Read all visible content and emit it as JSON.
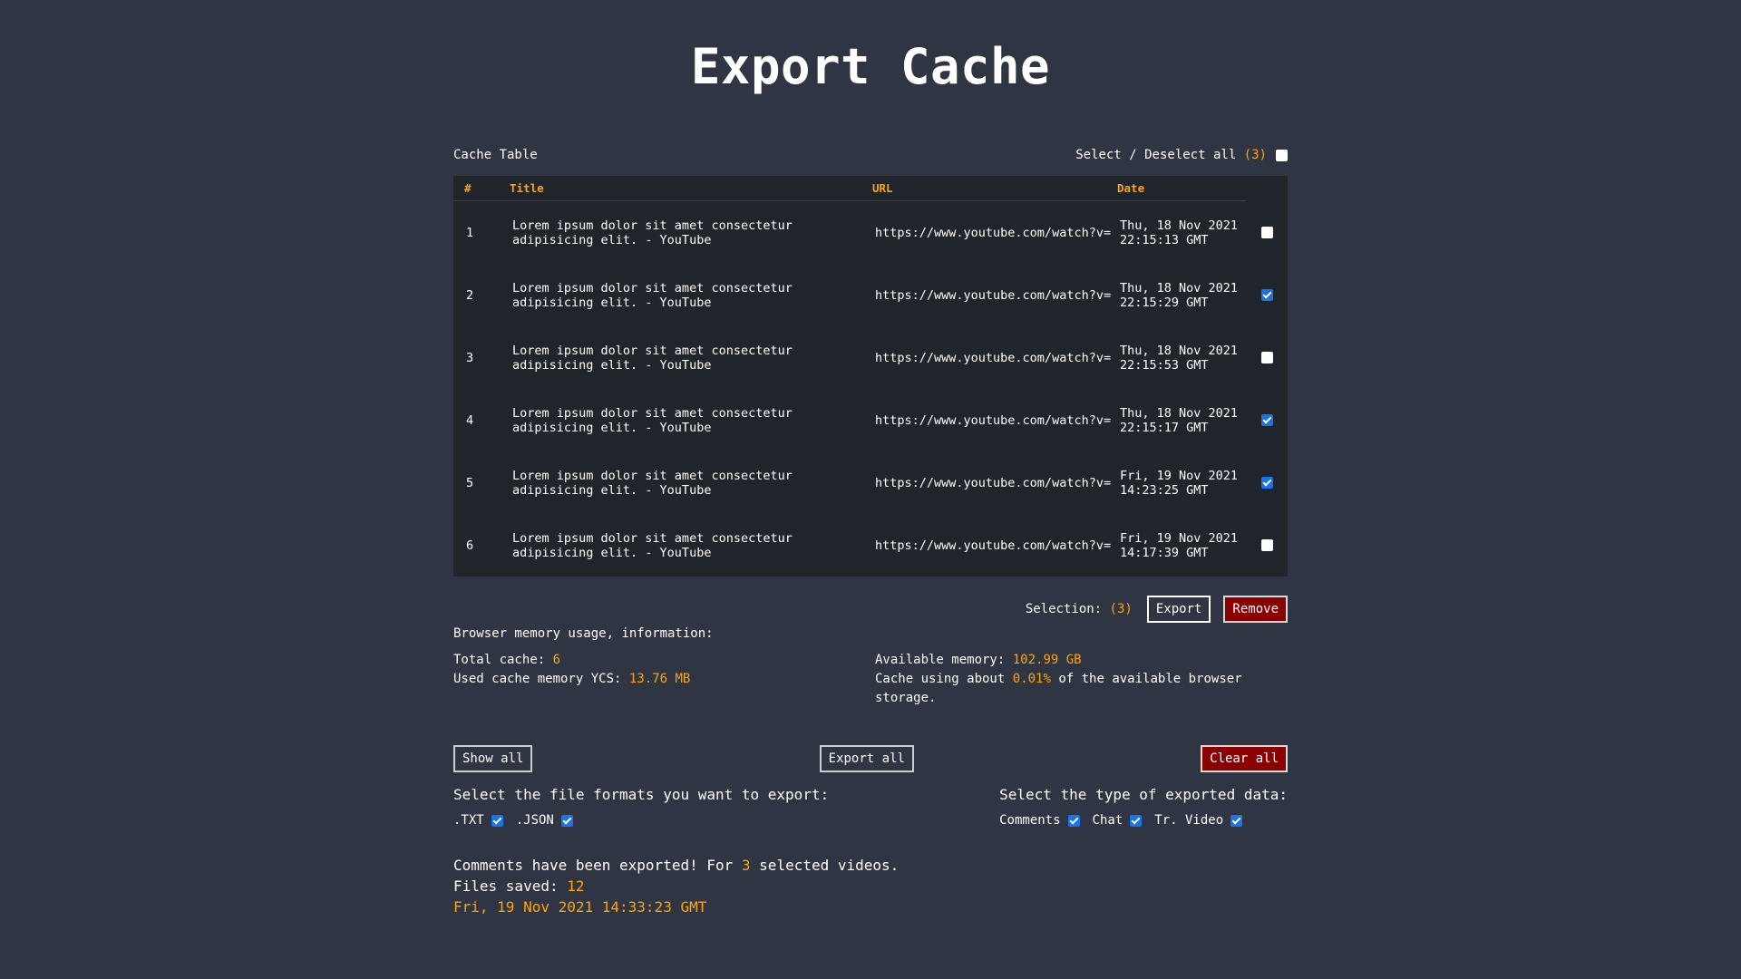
{
  "title": "Export Cache",
  "cache_table": {
    "label": "Cache Table",
    "select_all_label": "Select / Deselect all",
    "select_all_count": "(3)",
    "columns": {
      "num": "#",
      "title": "Title",
      "url": "URL",
      "date": "Date"
    },
    "rows": [
      {
        "num": "1",
        "title": "Lorem ipsum dolor sit amet consectetur adipisicing elit. - YouTube",
        "url": "https://www.youtube.com/watch?v=",
        "date": "Thu, 18 Nov 2021 22:15:13 GMT",
        "checked": false
      },
      {
        "num": "2",
        "title": "Lorem ipsum dolor sit amet consectetur adipisicing elit. - YouTube",
        "url": "https://www.youtube.com/watch?v=",
        "date": "Thu, 18 Nov 2021 22:15:29 GMT",
        "checked": true
      },
      {
        "num": "3",
        "title": "Lorem ipsum dolor sit amet consectetur adipisicing elit. - YouTube",
        "url": "https://www.youtube.com/watch?v=",
        "date": "Thu, 18 Nov 2021 22:15:53 GMT",
        "checked": false
      },
      {
        "num": "4",
        "title": "Lorem ipsum dolor sit amet consectetur adipisicing elit. - YouTube",
        "url": "https://www.youtube.com/watch?v=",
        "date": "Thu, 18 Nov 2021 22:15:17 GMT",
        "checked": true
      },
      {
        "num": "5",
        "title": "Lorem ipsum dolor sit amet consectetur adipisicing elit. - YouTube",
        "url": "https://www.youtube.com/watch?v=",
        "date": "Fri, 19 Nov 2021 14:23:25 GMT",
        "checked": true
      },
      {
        "num": "6",
        "title": "Lorem ipsum dolor sit amet consectetur adipisicing elit. - YouTube",
        "url": "https://www.youtube.com/watch?v=",
        "date": "Fri, 19 Nov 2021 14:17:39 GMT",
        "checked": false
      }
    ]
  },
  "selection": {
    "label": "Selection:",
    "count": "(3)",
    "export_label": "Export",
    "remove_label": "Remove"
  },
  "memory": {
    "title": "Browser memory usage, information:",
    "total_cache_label": "Total cache:",
    "total_cache_value": "6",
    "used_label": "Used cache memory YCS:",
    "used_value": "13.76 MB",
    "available_label": "Available memory:",
    "available_value": "102.99 GB",
    "usage_prefix": "Cache using about",
    "usage_value": "0.01%",
    "usage_suffix": "of the available browser storage."
  },
  "actions": {
    "show_all_label": "Show all",
    "export_all_label": "Export all",
    "clear_all_label": "Clear all"
  },
  "formats": {
    "title": "Select the file formats you want to export:",
    "options": [
      {
        "label": ".TXT",
        "checked": true
      },
      {
        "label": ".JSON",
        "checked": true
      }
    ]
  },
  "data_types": {
    "title": "Select the type of exported data:",
    "options": [
      {
        "label": "Comments",
        "checked": true
      },
      {
        "label": "Chat",
        "checked": true
      },
      {
        "label": "Tr. Video",
        "checked": true
      }
    ]
  },
  "status": {
    "line1_prefix": "Comments have been exported! For",
    "line1_count": "3",
    "line1_suffix": "selected videos.",
    "files_label": "Files saved:",
    "files_value": "12",
    "timestamp": "Fri, 19 Nov 2021 14:33:23 GMT"
  },
  "colors": {
    "background": "#2f3542",
    "table_background": "#20242b",
    "accent": "#ffa500",
    "checkbox_checked": "#1a73e8",
    "danger": "#8b0000"
  }
}
